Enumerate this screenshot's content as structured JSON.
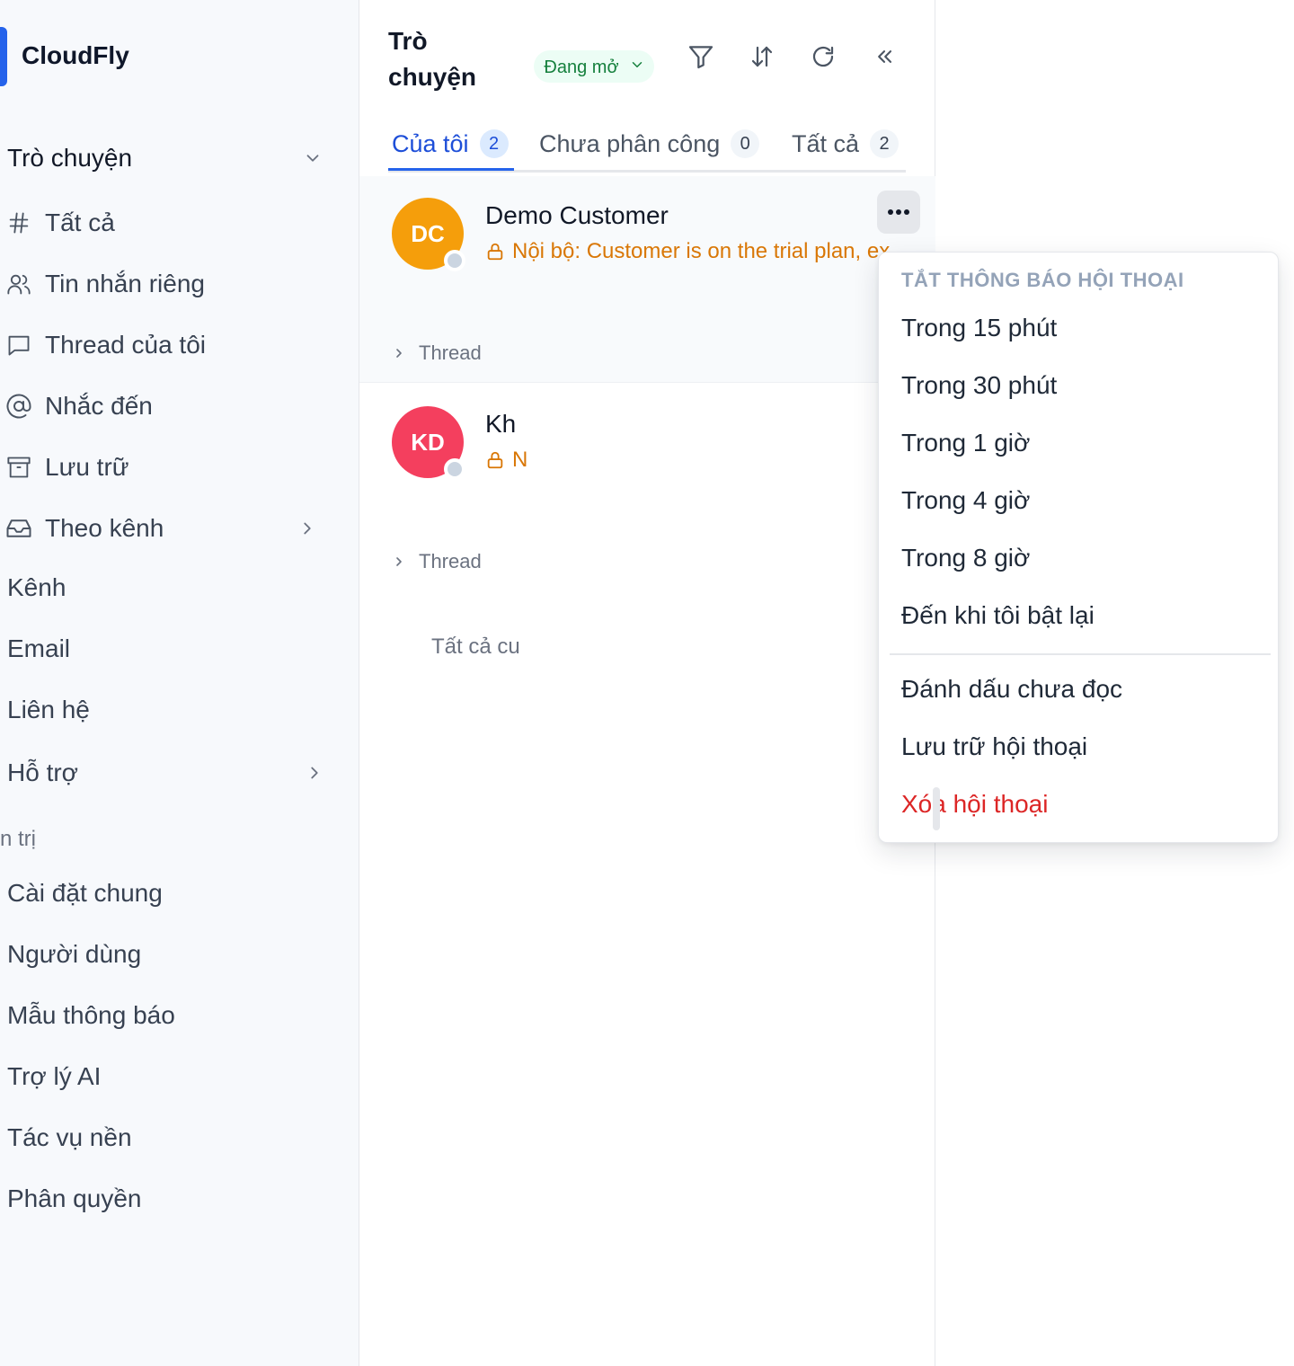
{
  "brand": {
    "name": "CloudFly",
    "accent": "#2563eb"
  },
  "sidebar": {
    "section_title": "Trò chuyện",
    "items": [
      {
        "label": "Tất cả",
        "icon": "hash-icon"
      },
      {
        "label": "Tin nhắn riêng",
        "icon": "users-icon"
      },
      {
        "label": "Thread của tôi",
        "icon": "message-square-icon"
      },
      {
        "label": "Nhắc đến",
        "icon": "at-sign-icon"
      },
      {
        "label": "Lưu trữ",
        "icon": "archive-icon"
      },
      {
        "label": "Theo kênh",
        "icon": "inbox-icon"
      }
    ],
    "links": [
      "Kênh",
      "Email",
      "Liên hệ",
      "Hỗ trợ"
    ],
    "admin_group_label": "n trị",
    "admin_links": [
      "Cài đặt chung",
      "Người dùng",
      "Mẫu thông báo",
      "Trợ lý AI",
      "Tác vụ nền",
      "Phân quyền"
    ]
  },
  "panel": {
    "title": "Trò chuyện",
    "status_filter": "Đang mở",
    "status_color": "#15803d",
    "tools": [
      "filter-icon",
      "sort-icon",
      "refresh-icon",
      "collapse-icon"
    ],
    "tabs": [
      {
        "label": "Của tôi",
        "count": "2",
        "active": true
      },
      {
        "label": "Chưa phân công",
        "count": "0",
        "active": false
      },
      {
        "label": "Tất cả",
        "count": "2",
        "active": false
      }
    ],
    "conversations": [
      {
        "initials": "DC",
        "name": "Demo Customer",
        "preview": "Nội bộ: Customer is on the trial plan, ex",
        "avatar_color": "#f59e0b",
        "thread_label": "Thread"
      },
      {
        "initials": "KD",
        "name": "Kh",
        "preview": "N",
        "avatar_color": "#f43f5e",
        "thread_label": "Thread"
      }
    ],
    "all_conversations_text": "Tất cả cu"
  },
  "menu": {
    "header": "TẮT THÔNG BÁO HỘI THOẠI",
    "mute_options": [
      "Trong 15 phút",
      "Trong 30 phút",
      "Trong 1 giờ",
      "Trong 4 giờ",
      "Trong 8 giờ",
      "Đến khi tôi bật lại"
    ],
    "mark_unread": "Đánh dấu chưa đọc",
    "archive": "Lưu trữ hội thoại",
    "delete": "Xóa hội thoại",
    "delete_color": "#dc2626"
  }
}
